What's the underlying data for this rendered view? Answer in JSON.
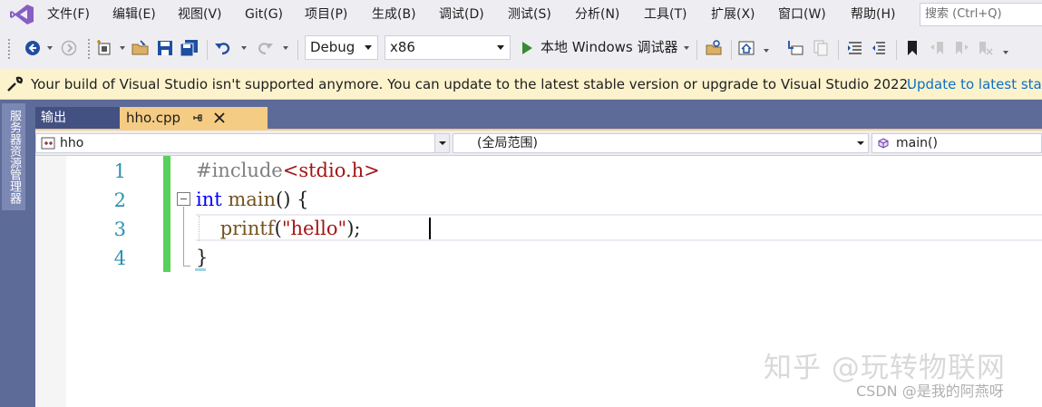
{
  "menu": {
    "items": [
      {
        "label": "文件(F)"
      },
      {
        "label": "编辑(E)"
      },
      {
        "label": "视图(V)"
      },
      {
        "label": "Git(G)"
      },
      {
        "label": "项目(P)"
      },
      {
        "label": "生成(B)"
      },
      {
        "label": "调试(D)"
      },
      {
        "label": "测试(S)"
      },
      {
        "label": "分析(N)"
      },
      {
        "label": "工具(T)"
      },
      {
        "label": "扩展(X)"
      },
      {
        "label": "窗口(W)"
      },
      {
        "label": "帮助(H)"
      }
    ],
    "search_placeholder": "搜索 (Ctrl+Q)"
  },
  "toolbar": {
    "configuration": "Debug",
    "platform": "x86",
    "run_label": "本地 Windows 调试器"
  },
  "infobar": {
    "message": "Your build of Visual Studio isn't supported anymore. You can update to the latest stable version or upgrade to Visual Studio 2022.",
    "link": "Update to latest stable"
  },
  "side_panel": {
    "server_explorer": "服务器资源管理器"
  },
  "tabs": {
    "output": "输出",
    "file": "hho.cpp"
  },
  "navbar": {
    "project": "hho",
    "scope": "(全局范围)",
    "member": "main()"
  },
  "editor": {
    "line_numbers": [
      "1",
      "2",
      "3",
      "4"
    ],
    "lines": {
      "l1": {
        "directive": "#include",
        "header": "<stdio.h>"
      },
      "l2": {
        "keyword": "int",
        "name": " main",
        "rest": "() {"
      },
      "l3": {
        "indent": "    ",
        "func": "printf",
        "open": "(",
        "str": "\"hello\"",
        "close": ");"
      },
      "l4": {
        "brace": "}"
      }
    }
  },
  "watermarks": {
    "zhihu": "知乎 @玩转物联网",
    "csdn": "CSDN @是我的阿燕呀"
  },
  "colors": {
    "accent_tab": "#f5cc84",
    "tab_strip": "#5d6b99",
    "infobar_bg": "#fcf3cd",
    "change_bar": "#57d15a",
    "keyword": "#0000ff",
    "string": "#a31515",
    "line_number": "#2b91af"
  }
}
